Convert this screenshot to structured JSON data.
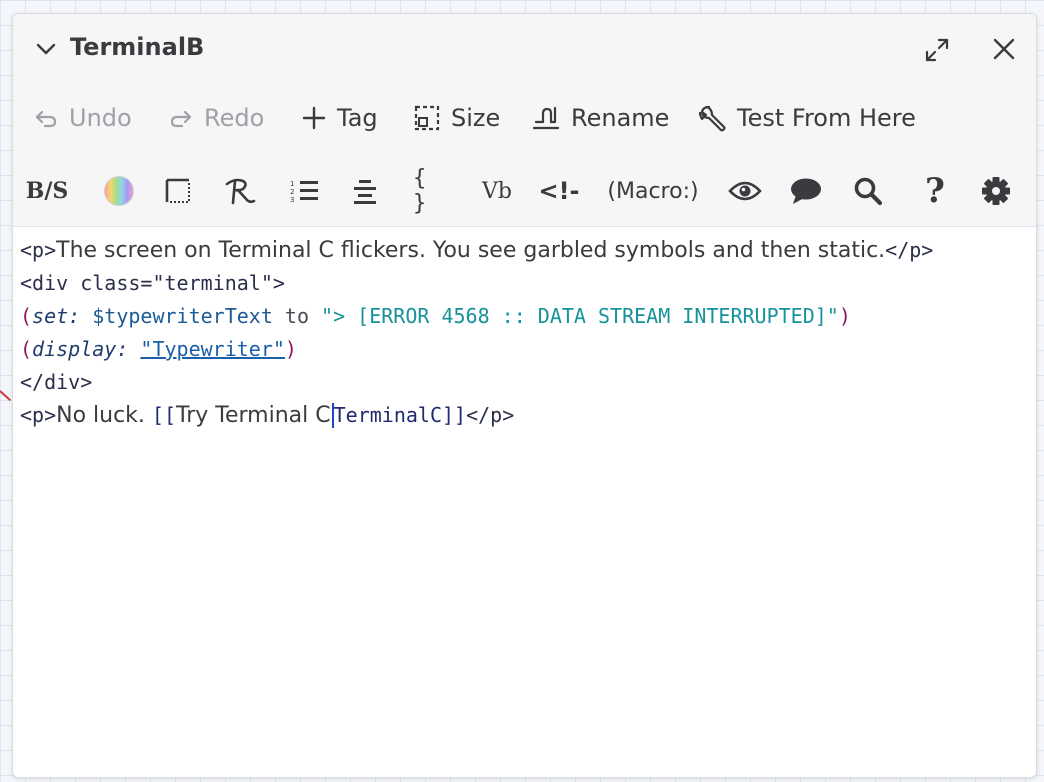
{
  "dialog": {
    "title": "TerminalB"
  },
  "toolbar": {
    "undo": "Undo",
    "redo": "Redo",
    "tag": "Tag",
    "size": "Size",
    "rename": "Rename",
    "test_from_here": "Test From Here"
  },
  "format_toolbar": {
    "bold_strike_label": "B/S",
    "verbatim_label": "Vb",
    "comment_label": "<!-",
    "braces_label": "{ }",
    "macro_label": "(Macro:)",
    "help_label": "?"
  },
  "code": {
    "line1": {
      "open_tag": "<p>",
      "text": "The screen on Terminal C flickers. You see garbled symbols and then static.",
      "close_tag": "</p>"
    },
    "line2": {
      "text": "<div class=\"terminal\">"
    },
    "line3": {
      "open": "(",
      "macro": "set:",
      "var": " $typewriterText",
      "kw": " to ",
      "string": "\"> [ERROR 4568 :: DATA STREAM INTERRUPTED]\"",
      "close": ")"
    },
    "line4": {
      "open": "(",
      "macro": "display:",
      "space": " ",
      "link": "\"Typewriter\"",
      "close": ")"
    },
    "line5": {
      "text": "</div>"
    },
    "line6": {
      "open_tag": "<p>",
      "text": "No luck. ",
      "open_brackets": "[[",
      "link_text": "Try Terminal C",
      "target": "TerminalC",
      "close_brackets": "]]",
      "close_tag": "</p>"
    }
  },
  "icons": {
    "collapse": "chevron-down-icon",
    "maximize": "maximize-icon",
    "close": "close-icon",
    "undo": "undo-arrow-icon",
    "redo": "redo-arrow-icon",
    "tag": "plus-icon",
    "size": "size-dashed-square-icon",
    "rename": "rename-signature-icon",
    "test": "wrench-icon",
    "color": "rainbow-color-icon",
    "border": "border-box-icon",
    "font": "font-style-icon",
    "list": "numbered-list-icon",
    "align": "align-center-icon",
    "preview": "eye-icon",
    "comment": "speech-bubble-icon",
    "find": "search-icon",
    "settings": "gear-icon"
  }
}
